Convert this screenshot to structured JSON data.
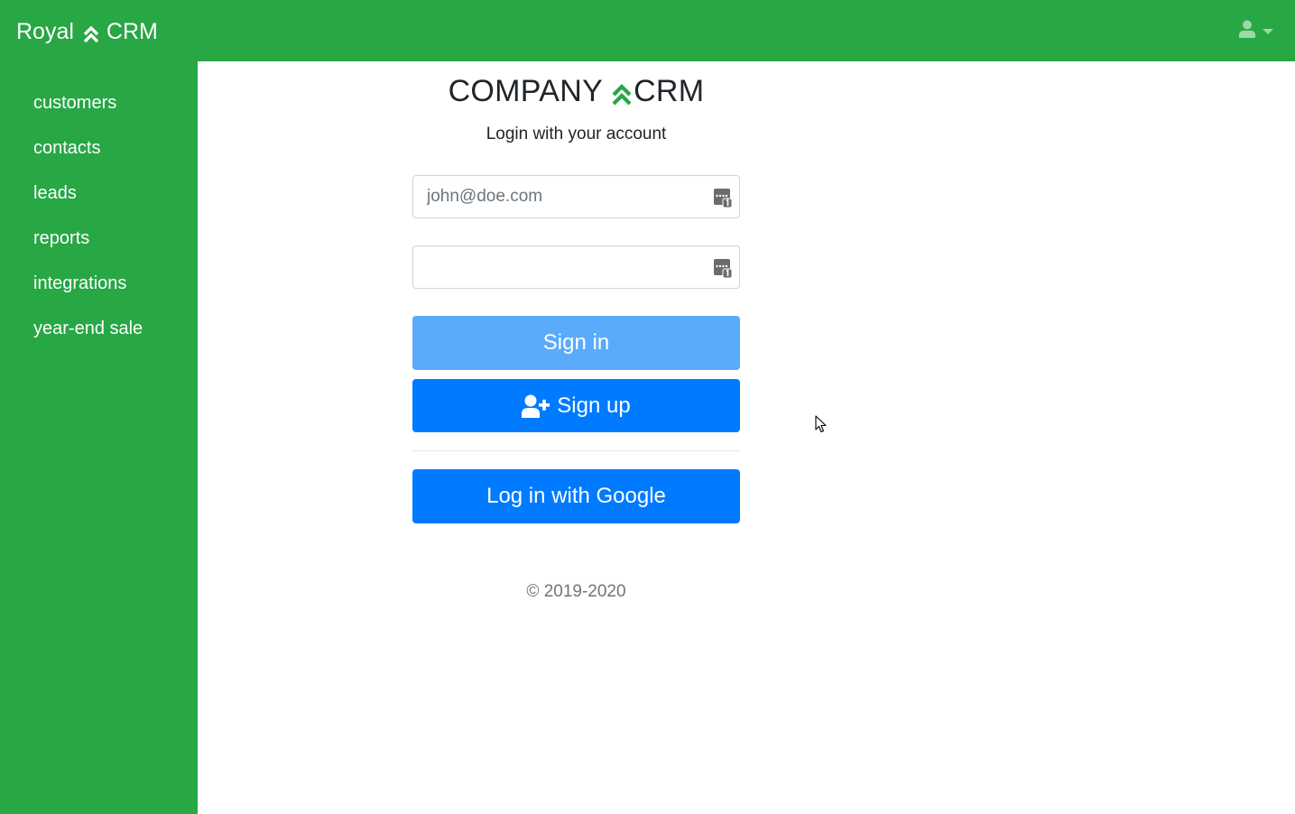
{
  "app": {
    "brand_left": "Royal",
    "brand_right": "CRM",
    "brand_icon": "chevrons-up-icon",
    "user_icon": "user-icon",
    "accent_color": "#28a745"
  },
  "sidebar": {
    "items": [
      {
        "label": "customers"
      },
      {
        "label": "contacts"
      },
      {
        "label": "leads"
      },
      {
        "label": "reports"
      },
      {
        "label": "integrations"
      },
      {
        "label": "year-end sale"
      }
    ]
  },
  "login": {
    "logo_left": "COMPANY",
    "logo_right": "CRM",
    "logo_icon": "chevrons-up-icon",
    "subtitle": "Login with your account",
    "email": {
      "placeholder": "john@doe.com",
      "value": "",
      "icon": "password-manager-icon"
    },
    "password": {
      "placeholder": "",
      "value": "",
      "icon": "password-manager-icon"
    },
    "signin_label": "Sign in",
    "signin_color": "#5aabfb",
    "signup_label": "Sign up",
    "signup_icon": "user-plus-icon",
    "signup_color": "#007bff",
    "google_label": "Log in with Google",
    "google_color": "#007bff",
    "copyright": "© 2019-2020"
  }
}
